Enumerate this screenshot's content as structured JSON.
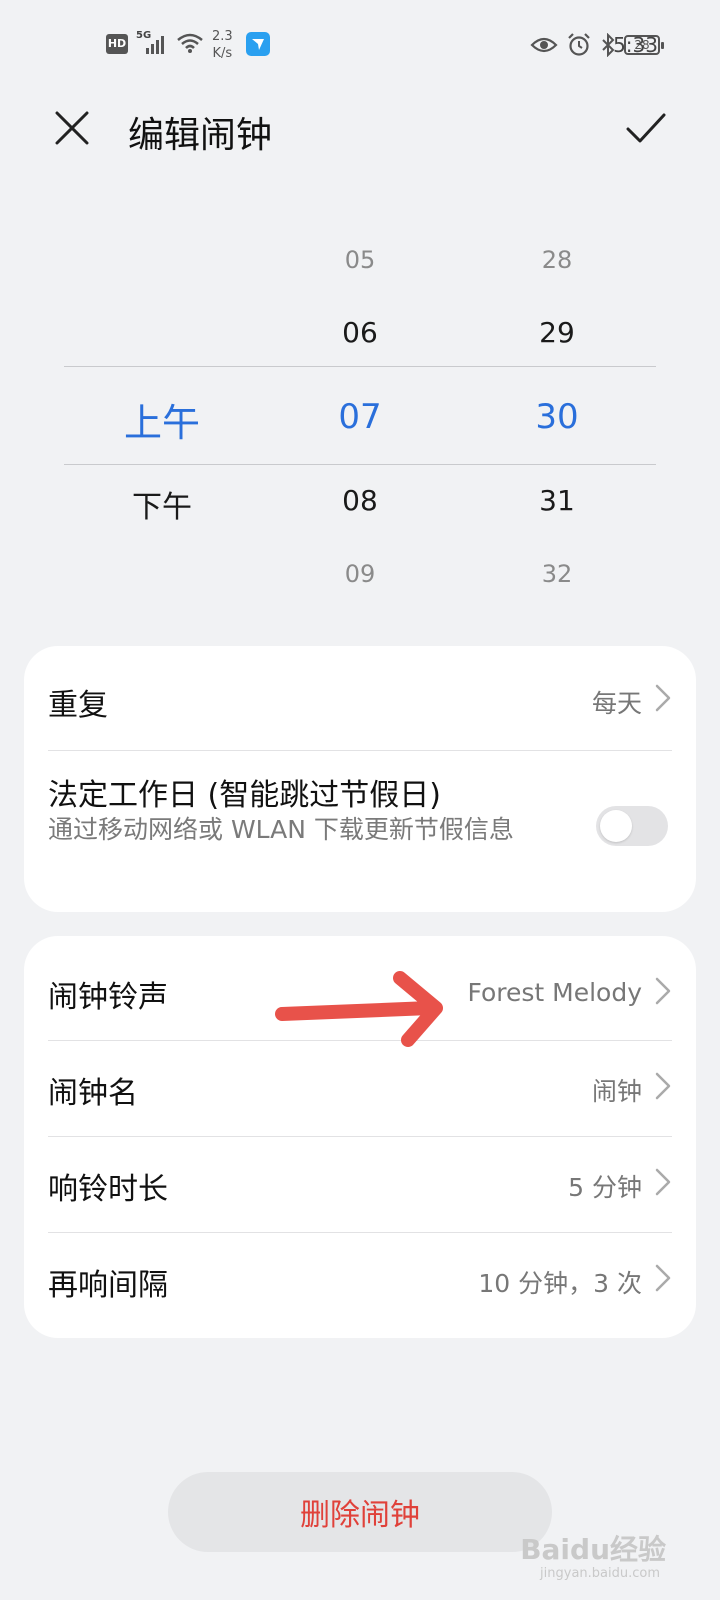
{
  "status_bar": {
    "hd": "HD",
    "network": "5G",
    "speed_top": "2.3",
    "speed_bottom": "K/s",
    "battery": "28",
    "time": "5:33"
  },
  "header": {
    "title": "编辑闹钟"
  },
  "picker": {
    "ampm": {
      "selected": "上午",
      "next": "下午"
    },
    "hours": [
      "05",
      "06",
      "07",
      "08",
      "09"
    ],
    "minutes": [
      "28",
      "29",
      "30",
      "31",
      "32"
    ]
  },
  "settings_card_1": {
    "repeat": {
      "label": "重复",
      "value": "每天"
    },
    "workday": {
      "label": "法定工作日 (智能跳过节假日)",
      "sub": "通过移动网络或 WLAN 下载更新节假信息",
      "enabled": false
    }
  },
  "settings_card_2": {
    "ringtone": {
      "label": "闹钟铃声",
      "value": "Forest Melody"
    },
    "name": {
      "label": "闹钟名",
      "value": "闹钟"
    },
    "duration": {
      "label": "响铃时长",
      "value": "5 分钟"
    },
    "snooze": {
      "label": "再响间隔",
      "value": "10 分钟，3 次"
    }
  },
  "delete_button": {
    "label": "删除闹钟"
  },
  "watermark": {
    "brand": "Baidu经验",
    "url": "jingyan.baidu.com"
  },
  "colors": {
    "accent": "#2a6fdb",
    "danger": "#e0413a",
    "arrow": "#e8524a"
  }
}
